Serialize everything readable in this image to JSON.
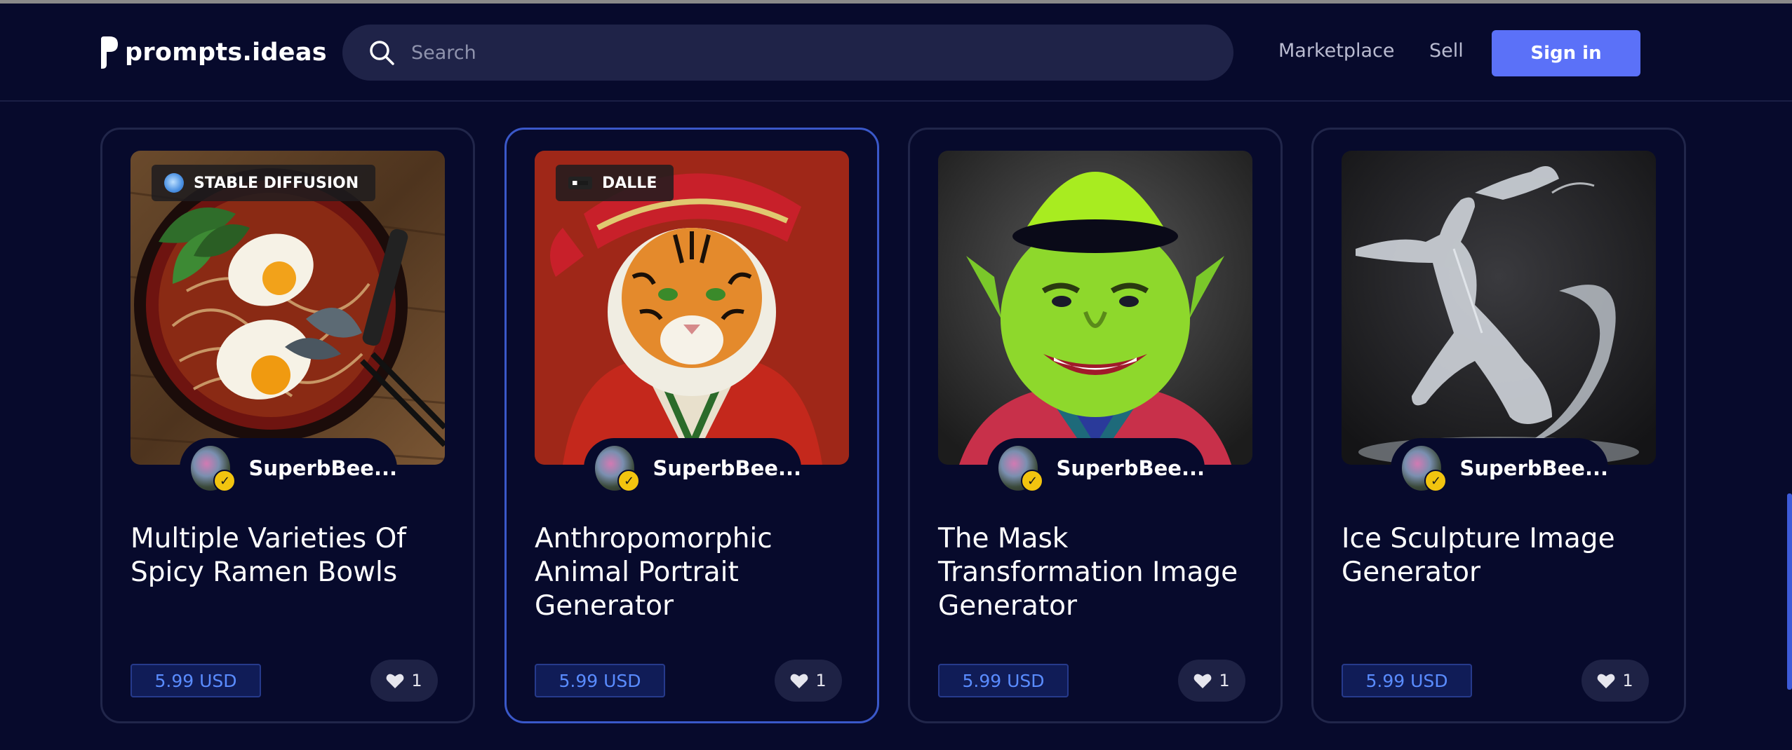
{
  "header": {
    "logo_text": "prompts.ideas",
    "search_placeholder": "Search",
    "nav": {
      "marketplace": "Marketplace",
      "sell": "Sell"
    },
    "signin_label": "Sign in"
  },
  "cards": [
    {
      "platform": "STABLE DIFFUSION",
      "author": "SuperbBee...",
      "title": "Multiple Varieties Of Spicy Ramen Bowls",
      "price": "5.99 USD",
      "likes": "1",
      "image_subject": "ramen-bowl"
    },
    {
      "platform": "DALLE",
      "author": "SuperbBee...",
      "title": "Anthropomorphic Animal Portrait Generator",
      "price": "5.99 USD",
      "likes": "1",
      "image_subject": "tiger-portrait"
    },
    {
      "platform": "",
      "author": "SuperbBee...",
      "title": "The Mask Transformation Image Generator",
      "price": "5.99 USD",
      "likes": "1",
      "image_subject": "green-mask-face"
    },
    {
      "platform": "",
      "author": "SuperbBee...",
      "title": "Ice Sculpture Image Generator",
      "price": "5.99 USD",
      "likes": "1",
      "image_subject": "ice-sculpture-dancer"
    }
  ],
  "icons": {
    "search": "search-icon",
    "heart": "heart-icon",
    "verified": "verified-badge-icon"
  },
  "colors": {
    "background": "#070a2c",
    "accent": "#5b71f8",
    "price_text": "#5a8cff",
    "selected_border": "#3a58c9"
  }
}
